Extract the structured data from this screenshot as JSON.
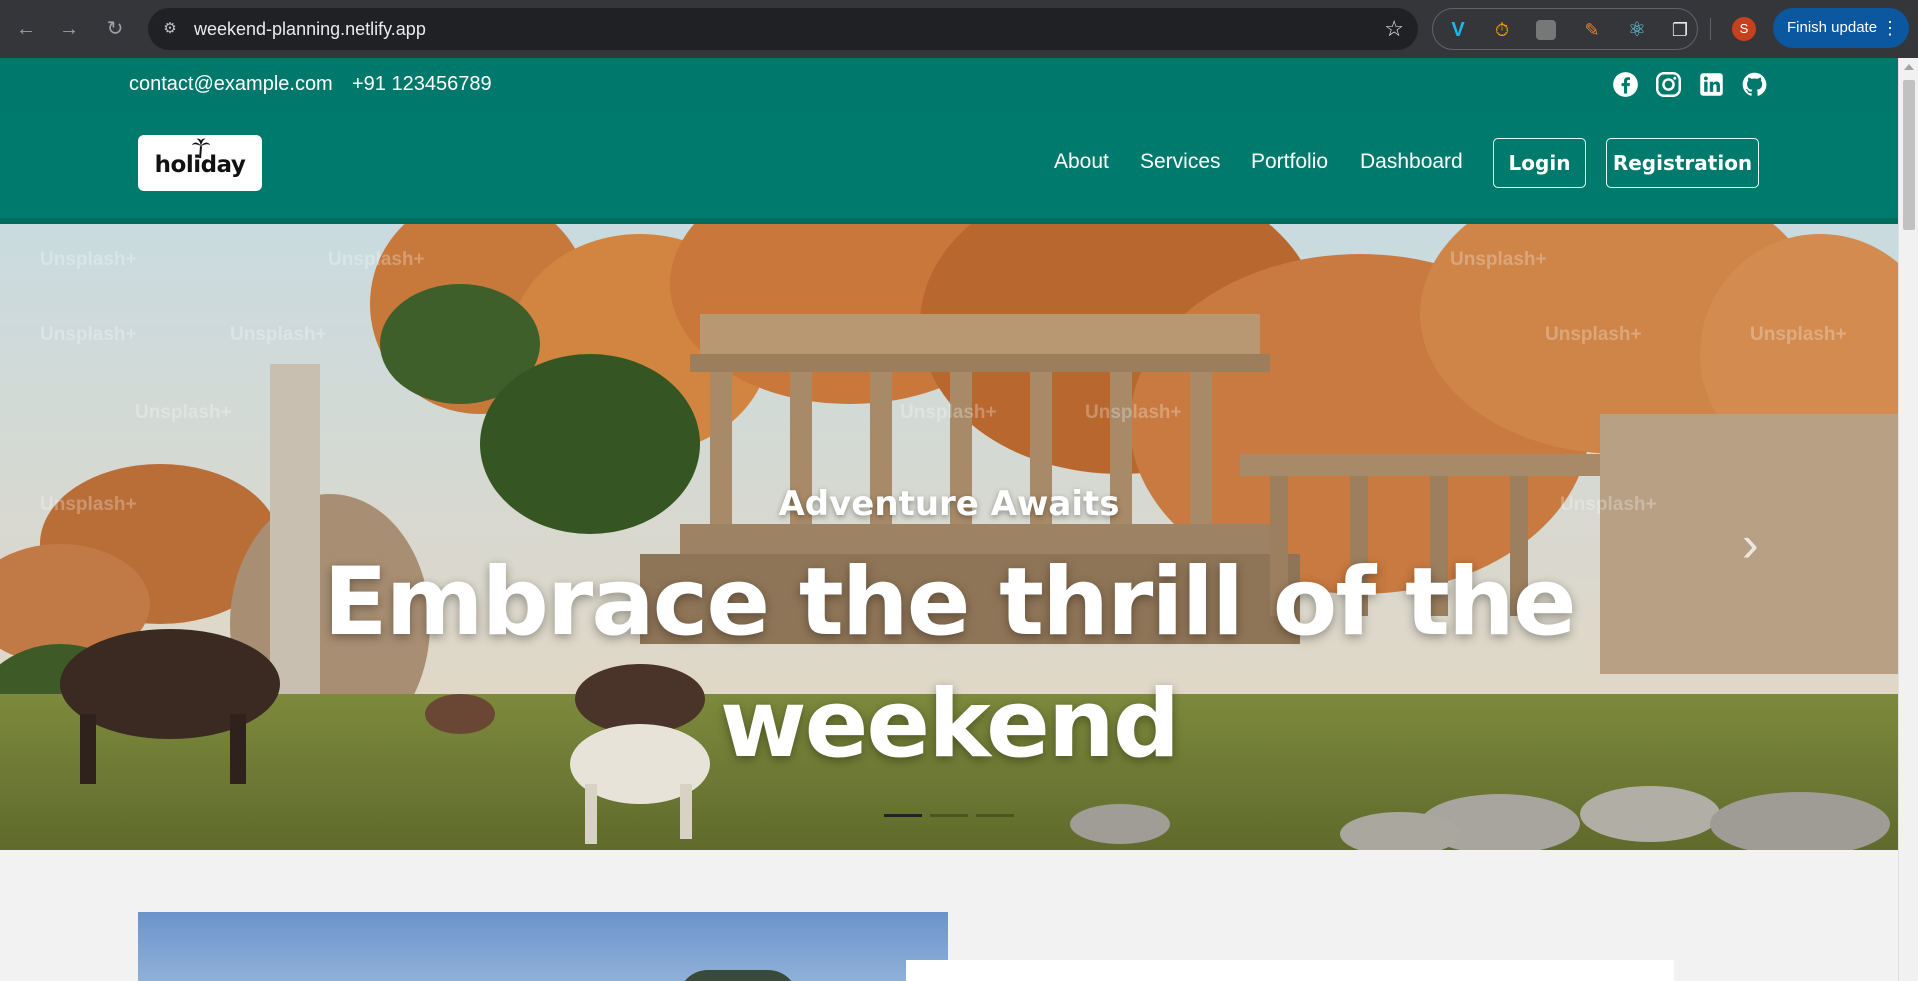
{
  "browser": {
    "url": "weekend-planning.netlify.app",
    "profile_initial": "S",
    "finish_update_label": "Finish update",
    "extensions": [
      "vimeo-icon",
      "timer-icon",
      "screen-capture-icon",
      "color-picker-icon",
      "react-devtools-icon",
      "extensions-puzzle-icon"
    ]
  },
  "topbar": {
    "email": "contact@example.com",
    "phone": "+91 123456789",
    "socials": [
      "facebook-icon",
      "instagram-icon",
      "linkedin-icon",
      "github-icon"
    ]
  },
  "nav": {
    "logo_text": "holiday",
    "links": [
      "About",
      "Services",
      "Portfolio",
      "Dashboard"
    ],
    "login_label": "Login",
    "registration_label": "Registration"
  },
  "hero": {
    "subtitle": "Adventure Awaits",
    "title": "Embrace the thrill of the weekend",
    "watermark": "Unsplash+",
    "slides_total": 3,
    "active_slide": 1
  },
  "colors": {
    "topbar": "#00786b",
    "nav": "#007a6d",
    "chrome": "#35363a",
    "finish_update": "#0b57a0"
  }
}
